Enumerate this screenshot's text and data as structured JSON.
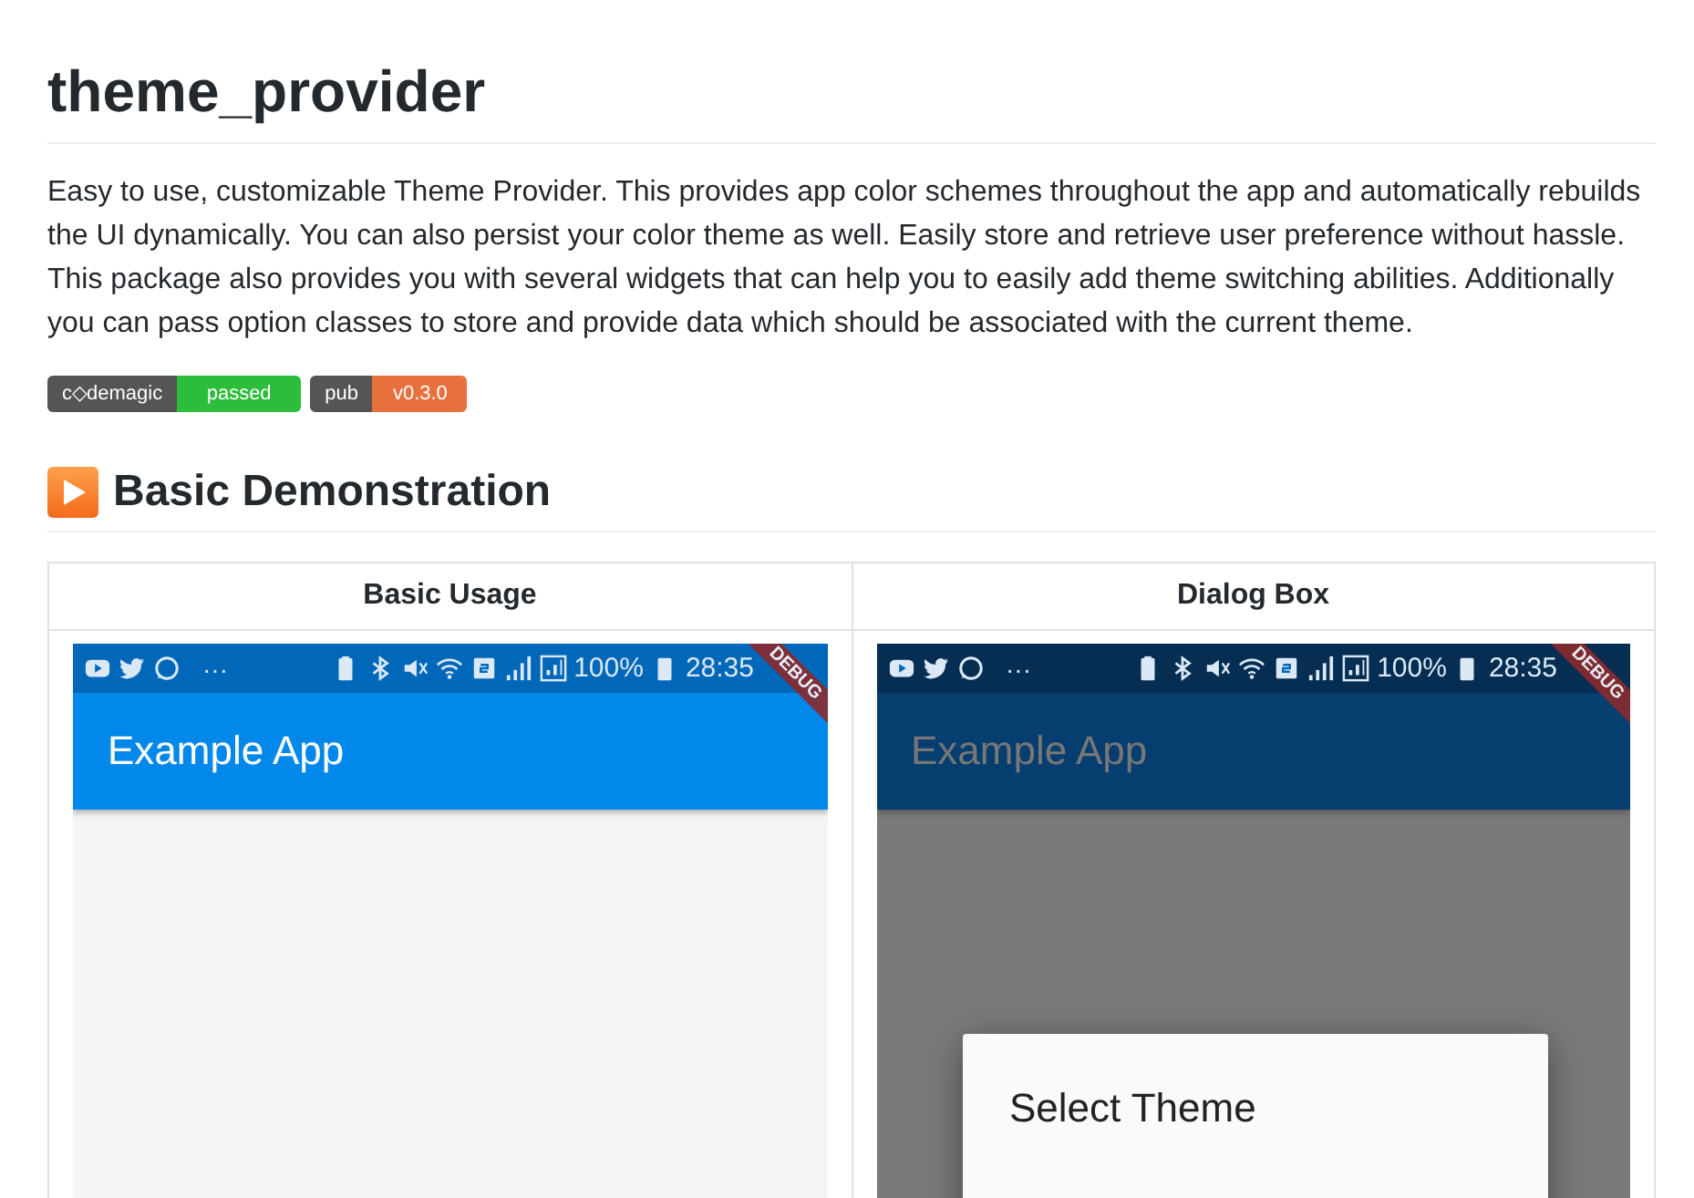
{
  "title": "theme_provider",
  "description": "Easy to use, customizable Theme Provider. This provides app color schemes throughout the app and automatically rebuilds the UI dynamically. You can also persist your color theme as well. Easily store and retrieve user preference without hassle. This package also provides you with several widgets that can help you to easily add theme switching abilities. Additionally you can pass option classes to store and provide data which should be associated with the current theme.",
  "badges": [
    {
      "label": "c◇demagic",
      "value": "passed",
      "color": "#2cbd3a"
    },
    {
      "label": "pub",
      "value": "v0.3.0",
      "color": "#e8703d"
    }
  ],
  "section_heading": "Basic Demonstration",
  "table": {
    "columns": [
      "Basic Usage",
      "Dialog Box"
    ],
    "phones": [
      {
        "kind": "plain",
        "dots": "···",
        "battery": "100%",
        "time": "28:35",
        "banner": "DEBUG",
        "app_title": "Example App",
        "dimmed": false
      },
      {
        "kind": "dialog",
        "dots": "···",
        "battery": "100%",
        "time": "28:35",
        "banner": "DEBUG",
        "app_title": "Example App",
        "dimmed": true,
        "dialog_title": "Select Theme"
      }
    ]
  }
}
